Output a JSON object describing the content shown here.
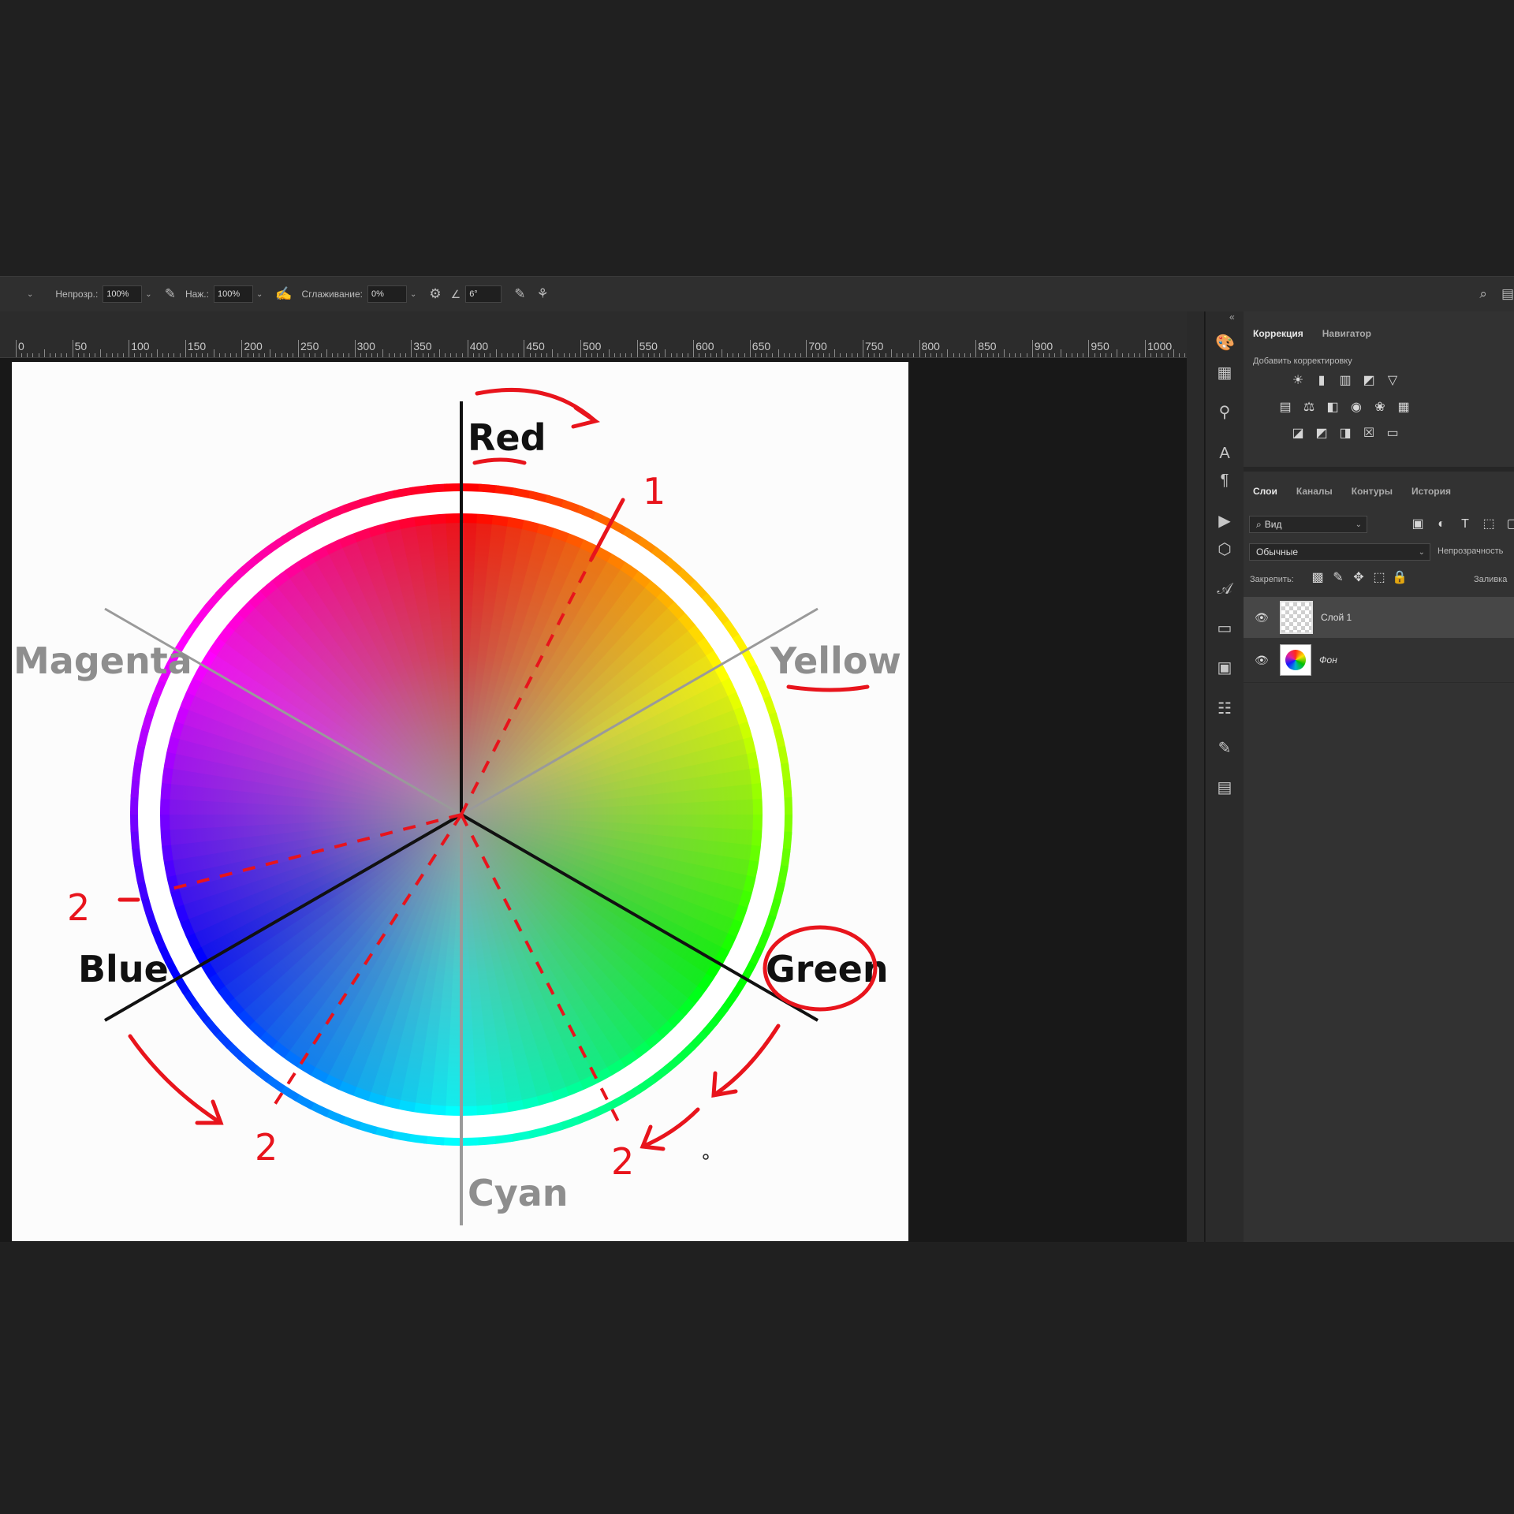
{
  "options_bar": {
    "opacity_label": "Непрозр.:",
    "opacity_value": "100%",
    "flow_label": "Наж.:",
    "flow_value": "100%",
    "smoothing_label": "Сглаживание:",
    "smoothing_value": "0%",
    "angle_value": "6°"
  },
  "ruler": {
    "labels": [
      "0",
      "50",
      "100",
      "150",
      "200",
      "250",
      "300",
      "350",
      "400",
      "450",
      "500",
      "550",
      "600",
      "650",
      "700",
      "750",
      "800",
      "850",
      "900",
      "950",
      "1000"
    ]
  },
  "canvas": {
    "labels": {
      "red": "Red",
      "yellow": "Yellow",
      "magenta": "Magenta",
      "blue": "Blue",
      "green": "Green",
      "cyan": "Cyan"
    },
    "annotations": {
      "one": "1",
      "two_a": "2",
      "two_b": "2",
      "two_c": "2"
    },
    "colors": {
      "red": "#ff2a1a",
      "yellow": "#ffe100",
      "green": "#00c000",
      "cyan": "#00b0d0",
      "blue": "#1818ff",
      "magenta": "#e020a0",
      "annotation": "#e8141c"
    }
  },
  "adjust_panel": {
    "tab_correction": "Коррекция",
    "tab_navigator": "Навигатор",
    "add_adjustment": "Добавить корректировку"
  },
  "layers_panel": {
    "tabs": [
      "Слои",
      "Каналы",
      "Контуры",
      "История"
    ],
    "filter_kind": "Вид",
    "blend_mode": "Обычные",
    "opacity_label": "Непрозрачность",
    "lock_label": "Закрепить:",
    "fill_label": "Заливка",
    "layers": [
      {
        "name": "Слой 1"
      },
      {
        "name": "Фон"
      }
    ]
  }
}
